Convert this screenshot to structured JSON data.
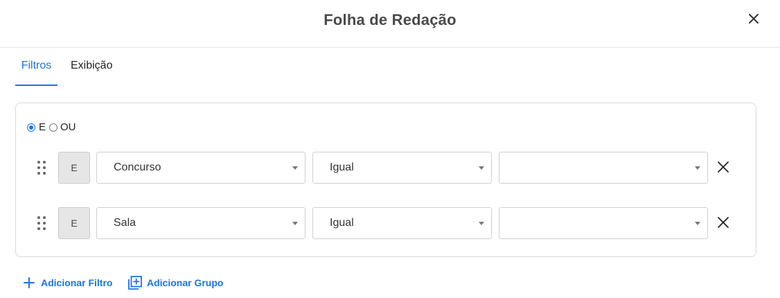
{
  "dialog": {
    "title": "Folha de Redação",
    "close_icon": "close-icon"
  },
  "tabs": [
    {
      "label": "Filtros",
      "active": true
    },
    {
      "label": "Exibição",
      "active": false
    }
  ],
  "logic": {
    "options": [
      {
        "label": "E",
        "selected": true
      },
      {
        "label": "OU",
        "selected": false
      }
    ]
  },
  "filters": [
    {
      "operator": "E",
      "field": "Concurso",
      "comparison": "Igual",
      "value": ""
    },
    {
      "operator": "E",
      "field": "Sala",
      "comparison": "Igual",
      "value": ""
    }
  ],
  "actions": {
    "add_filter": "Adicionar Filtro",
    "add_group": "Adicionar Grupo"
  },
  "colors": {
    "accent": "#1a73e8"
  }
}
